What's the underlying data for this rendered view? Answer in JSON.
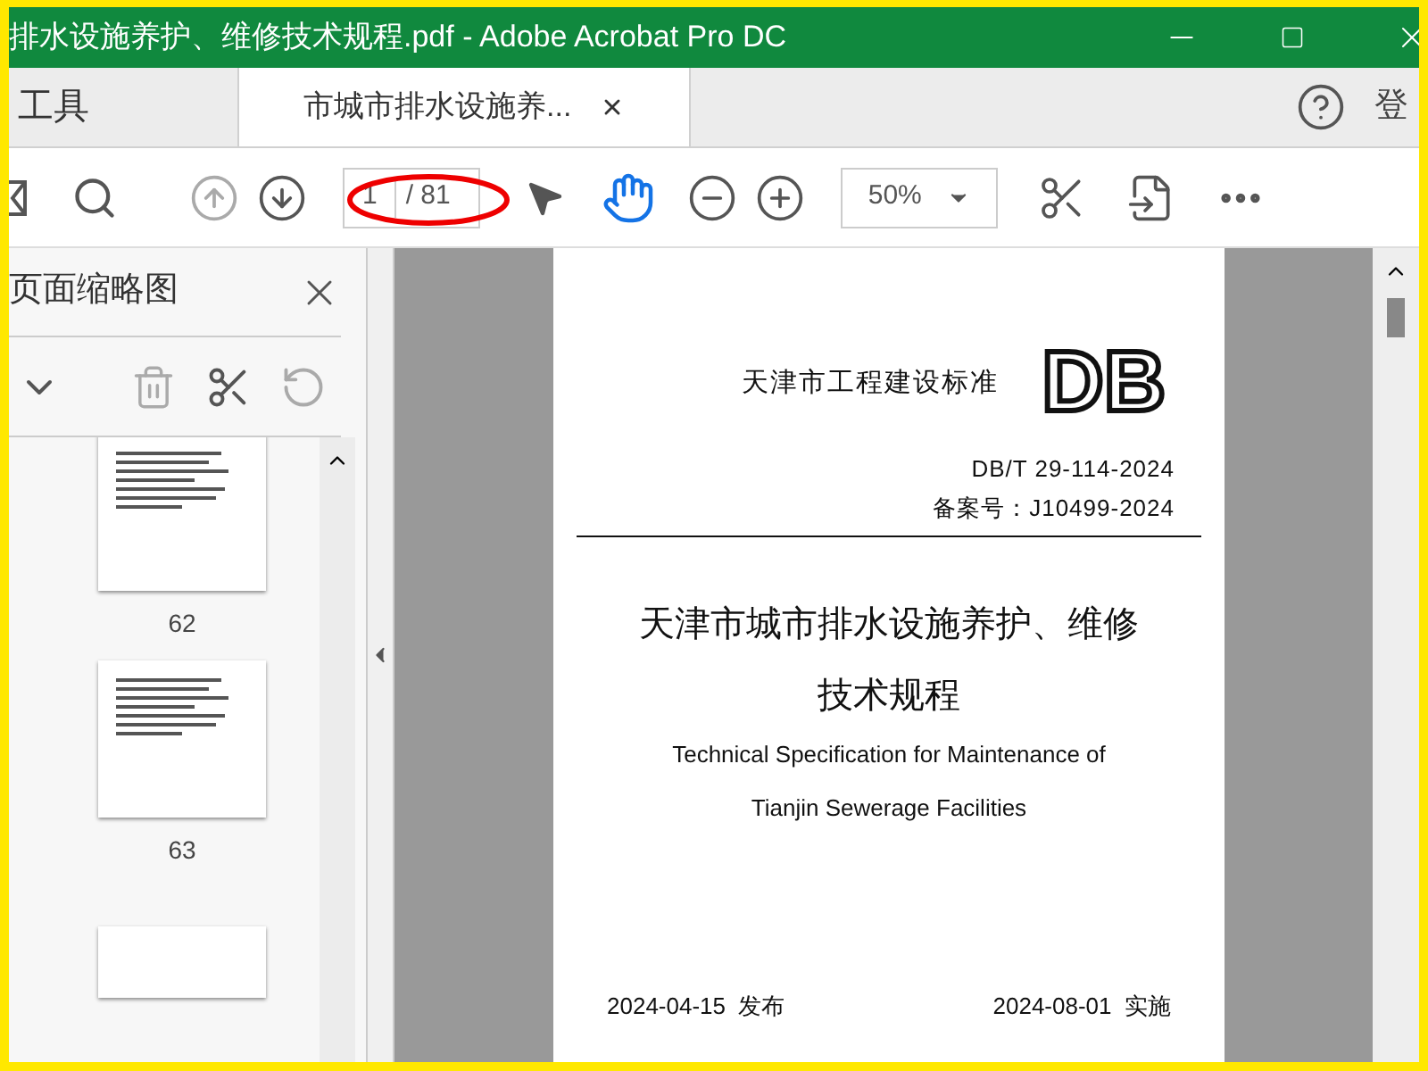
{
  "window": {
    "title": "排水设施养护、维修技术规程.pdf - Adobe Acrobat Pro DC"
  },
  "tabs": [
    {
      "label": "工具",
      "selected": false
    },
    {
      "label": "市城市排水设施养...",
      "selected": true,
      "closable": true
    }
  ],
  "account": {
    "label": "登"
  },
  "toolbar": {
    "page_value": "1",
    "page_total": "/ 81",
    "zoom": "50%",
    "annotation": true
  },
  "thumbnails": {
    "title": "页面缩略图",
    "pages": [
      {
        "label": "62"
      },
      {
        "label": "63"
      }
    ]
  },
  "document": {
    "series": "天津市工程建设标准",
    "logo": "DB",
    "code": "DB/T 29-114-2024",
    "record": "备案号：J10499-2024",
    "title_lines": [
      "天津市城市排水设施养护、维修",
      "技术规程"
    ],
    "english_lines": [
      "Technical Specification for Maintenance of",
      "Tianjin Sewerage Facilities"
    ],
    "issued": "2024-04-15  发布",
    "effective": "2024-08-01  实施"
  }
}
